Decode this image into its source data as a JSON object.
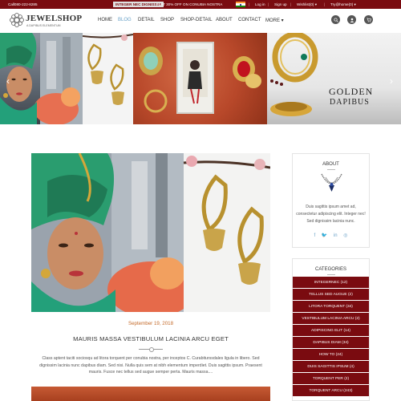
{
  "topbar": {
    "phone": "Call080-222-8285",
    "badge": "INTEGER NEC DIGNISSIM",
    "promo": "FLAT 30% OFF ON CONUBIA NOSTRA",
    "links": [
      "Log in",
      "Sign up",
      "Wishlist(0) ▾",
      "Try@home(0) ▾"
    ]
  },
  "header": {
    "logo_title": "JEWELSHOP",
    "logo_subtitle": "A DAPIBUS ELEMENTUM",
    "nav": [
      "HOME",
      "BLOG",
      "DETAIL",
      "SHOP",
      "SHOP-DETAIL",
      "ABOUT",
      "CONTACT",
      "MORE ▾"
    ],
    "active_nav": "BLOG",
    "icons": [
      "search-icon",
      "user-icon",
      "cart-icon"
    ]
  },
  "slider": {
    "caption_line1": "GOLDEN",
    "caption_line2": "DAPIBUS",
    "prev": "‹",
    "next": "›"
  },
  "post": {
    "date": "September 19, 2018",
    "title": "MAURIS MASSA VESTIBULUM LACINIA ARCU EGET",
    "excerpt": "Class aptent taciti sociosqu ad litora torquent per conubia nostra, per inceptos C. Curabiturssdales ligula in libero. Sed dignissim lacinia nunc dapibus diam. Sed nisi. Nulla quis sem at nibh elementum imperdiet. Duis sagittis ipsum. Praesent mauris. Fusce nec tellus sed augue semper perta. Mauris massa...."
  },
  "about_widget": {
    "title": "ABOUT",
    "description": "Duis sagittis ipsum amet ad, consectetur adipiscing elit. Integer nec! Sed dignissim lacinia nunc.",
    "social": [
      "f",
      "🐦",
      "in",
      "◎"
    ]
  },
  "categories_widget": {
    "title": "CATEGORIES",
    "items": [
      "INTEGERNEC (12)",
      "TELLUS SED AUGUE (2)",
      "LITORA TORQUENT (34)",
      "VESTIBULUM LACINIA ARCU (2)",
      "ADIPISCING ELIT (14)",
      "DAPIBUS DIAM (34)",
      "HOW TO (24)",
      "DUIS SAGITTIS IPSUM (4)",
      "TORQUENT PER (2)",
      "TORQUENT ARCU (243)"
    ]
  },
  "colors": {
    "brand": "#7a0b10",
    "accent": "#6aa2c8",
    "date": "#c46a2a"
  }
}
